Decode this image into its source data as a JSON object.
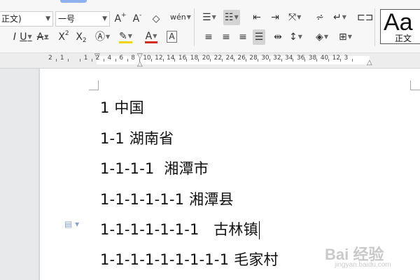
{
  "toolbar": {
    "font_name": "正文)",
    "font_size": "一号",
    "style_preview": {
      "label": "Aa",
      "name": "正文"
    }
  },
  "ruler": {
    "numbers": [
      "2",
      "1",
      "",
      "1",
      "2",
      "4",
      "6",
      "8",
      "10",
      "12",
      "14",
      "16",
      "18",
      "20",
      "22",
      "24",
      "26",
      "28",
      "30",
      "32",
      "34",
      "36",
      "38",
      "40",
      "12",
      "3"
    ]
  },
  "document": {
    "lines": [
      "1 中国",
      "1-1 湖南省",
      "1-1-1-1  湘潭市",
      "1-1-1-1-1-1 湘潭县",
      "1-1-1-1-1-1-1   古林镇",
      "1-1-1-1-1-1-1-1-1 毛家村"
    ]
  },
  "watermark": {
    "brand": "Bai 经验",
    "url": "jingyan.baidu.com"
  }
}
